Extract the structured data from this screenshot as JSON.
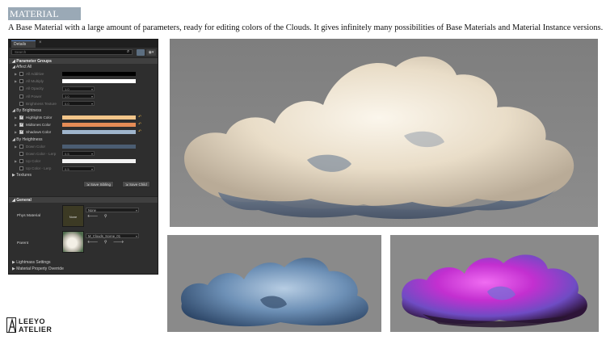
{
  "header": {
    "title": "MATERIAL",
    "description": "A Base Material with a large amount of parameters, ready for editing colors of the Clouds. It gives infinitely many possibilities of Base Materials and Material Instance versions."
  },
  "details_panel": {
    "tab_label": "Details",
    "search_placeholder": "Search",
    "sections": {
      "parameter_groups": "Parameter Groups",
      "affect_all": "Affect All",
      "by_brightness": "By Brightness",
      "by_height": "By Heightness",
      "textures": "Textures",
      "general": "General",
      "lightmass": "Lightmass Settings",
      "material_property_override": "Material Property Override"
    },
    "affect_all_params": [
      {
        "label": "All Additive",
        "enabled": false
      },
      {
        "label": "All Multiply",
        "enabled": false
      },
      {
        "label": "All Opacity",
        "value": "1.0",
        "enabled": false
      },
      {
        "label": "All Power",
        "value": "1.0",
        "enabled": false
      },
      {
        "label": "Brightness Texture",
        "value": "0.0",
        "enabled": false
      }
    ],
    "brightness_params": [
      {
        "label": "Highlights Color",
        "enabled": true
      },
      {
        "label": "Midtones Color",
        "enabled": true
      },
      {
        "label": "Shadows Color",
        "enabled": true
      }
    ],
    "height_params": [
      {
        "label": "Down Color",
        "enabled": false
      },
      {
        "label": "Down Color - Lerp",
        "value": "0.5",
        "enabled": false
      },
      {
        "label": "Up Color",
        "enabled": false
      },
      {
        "label": "Up Color - Lerp",
        "value": "0.5",
        "enabled": false
      }
    ],
    "buttons": {
      "save_sibling": "⇲ Save Sibling",
      "save_child": "⇲ Save Child"
    },
    "general": {
      "phys_material_label": "Phys Material",
      "phys_material_thumb": "None",
      "phys_material_value": "None",
      "parent_label": "Parent",
      "parent_value": "M_Clouds_Scene_01"
    },
    "colors": {
      "all_additive": "#000000",
      "all_multiply": "#ffffff",
      "highlights": "#f2c58a",
      "midtones": "#e58c56",
      "shadows": "#9fb5cc",
      "down_color": "#4b5d72",
      "up_color": "#f2f2f2",
      "reset_arrow": "#d9a441"
    },
    "icons": [
      "search-icon",
      "grid-view-icon",
      "eye-icon",
      "reset-arrow-icon",
      "browse-arrow-icon",
      "magnifier-icon"
    ]
  },
  "images": [
    {
      "name": "white-cloud-render"
    },
    {
      "name": "blue-cloud-render"
    },
    {
      "name": "magenta-cloud-render"
    }
  ],
  "branding": {
    "logo_line1": "LEEYO",
    "logo_line2": "ATELIER"
  }
}
